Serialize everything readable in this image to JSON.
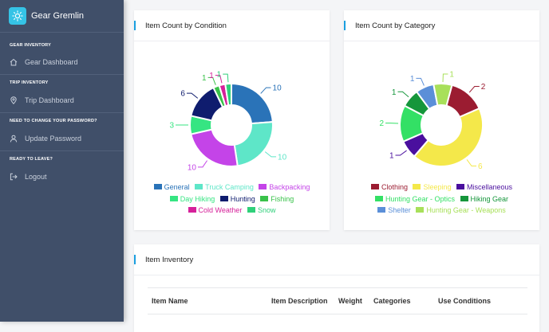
{
  "app": {
    "name": "Gear Gremlin",
    "brand_color": "#35c3e6"
  },
  "sidebar": {
    "sections": [
      {
        "heading": "GEAR INVENTORY",
        "item": {
          "label": "Gear Dashboard",
          "icon": "home-icon"
        }
      },
      {
        "heading": "TRIP INVENTORY",
        "item": {
          "label": "Trip Dashboard",
          "icon": "map-pin-icon"
        }
      },
      {
        "heading": "NEED TO CHANGE YOUR PASSWORD?",
        "item": {
          "label": "Update Password",
          "icon": "user-icon"
        }
      },
      {
        "heading": "READY TO LEAVE?",
        "item": {
          "label": "Logout",
          "icon": "logout-icon"
        }
      }
    ]
  },
  "condition_card": {
    "title": "Item Count by Condition"
  },
  "category_card": {
    "title": "Item Count by Category"
  },
  "inventory_card": {
    "title": "Item Inventory",
    "columns": [
      "Item Name",
      "Item Description",
      "Weight",
      "Categories",
      "Use Conditions"
    ]
  },
  "chart_data": [
    {
      "type": "pie",
      "title": "Item Count by Condition",
      "categories": [
        "General",
        "Truck Camping",
        "Backpacking",
        "Day Hiking",
        "Hunting",
        "Fishing",
        "Cold Weather",
        "Snow"
      ],
      "values": [
        10,
        10,
        10,
        3,
        6,
        1,
        1,
        1
      ],
      "colors": [
        "#2a73b8",
        "#5ee6c8",
        "#c444e8",
        "#36e582",
        "#0f1c6e",
        "#39c24a",
        "#d6219a",
        "#2fd07a"
      ],
      "legend_placement": "bottom"
    },
    {
      "type": "pie",
      "title": "Item Count by Category",
      "categories": [
        "Clothing",
        "Sleeping",
        "Miscellaneous",
        "Hunting Gear - Optics",
        "Hiking Gear",
        "Shelter",
        "Hunting Gear - Weapons"
      ],
      "values": [
        2,
        6,
        1,
        2,
        1,
        1,
        1
      ],
      "colors": [
        "#9b1c31",
        "#f4e84a",
        "#4a0f9e",
        "#33e065",
        "#15963b",
        "#5b8fd8",
        "#a8e05a"
      ],
      "legend_placement": "bottom"
    }
  ]
}
